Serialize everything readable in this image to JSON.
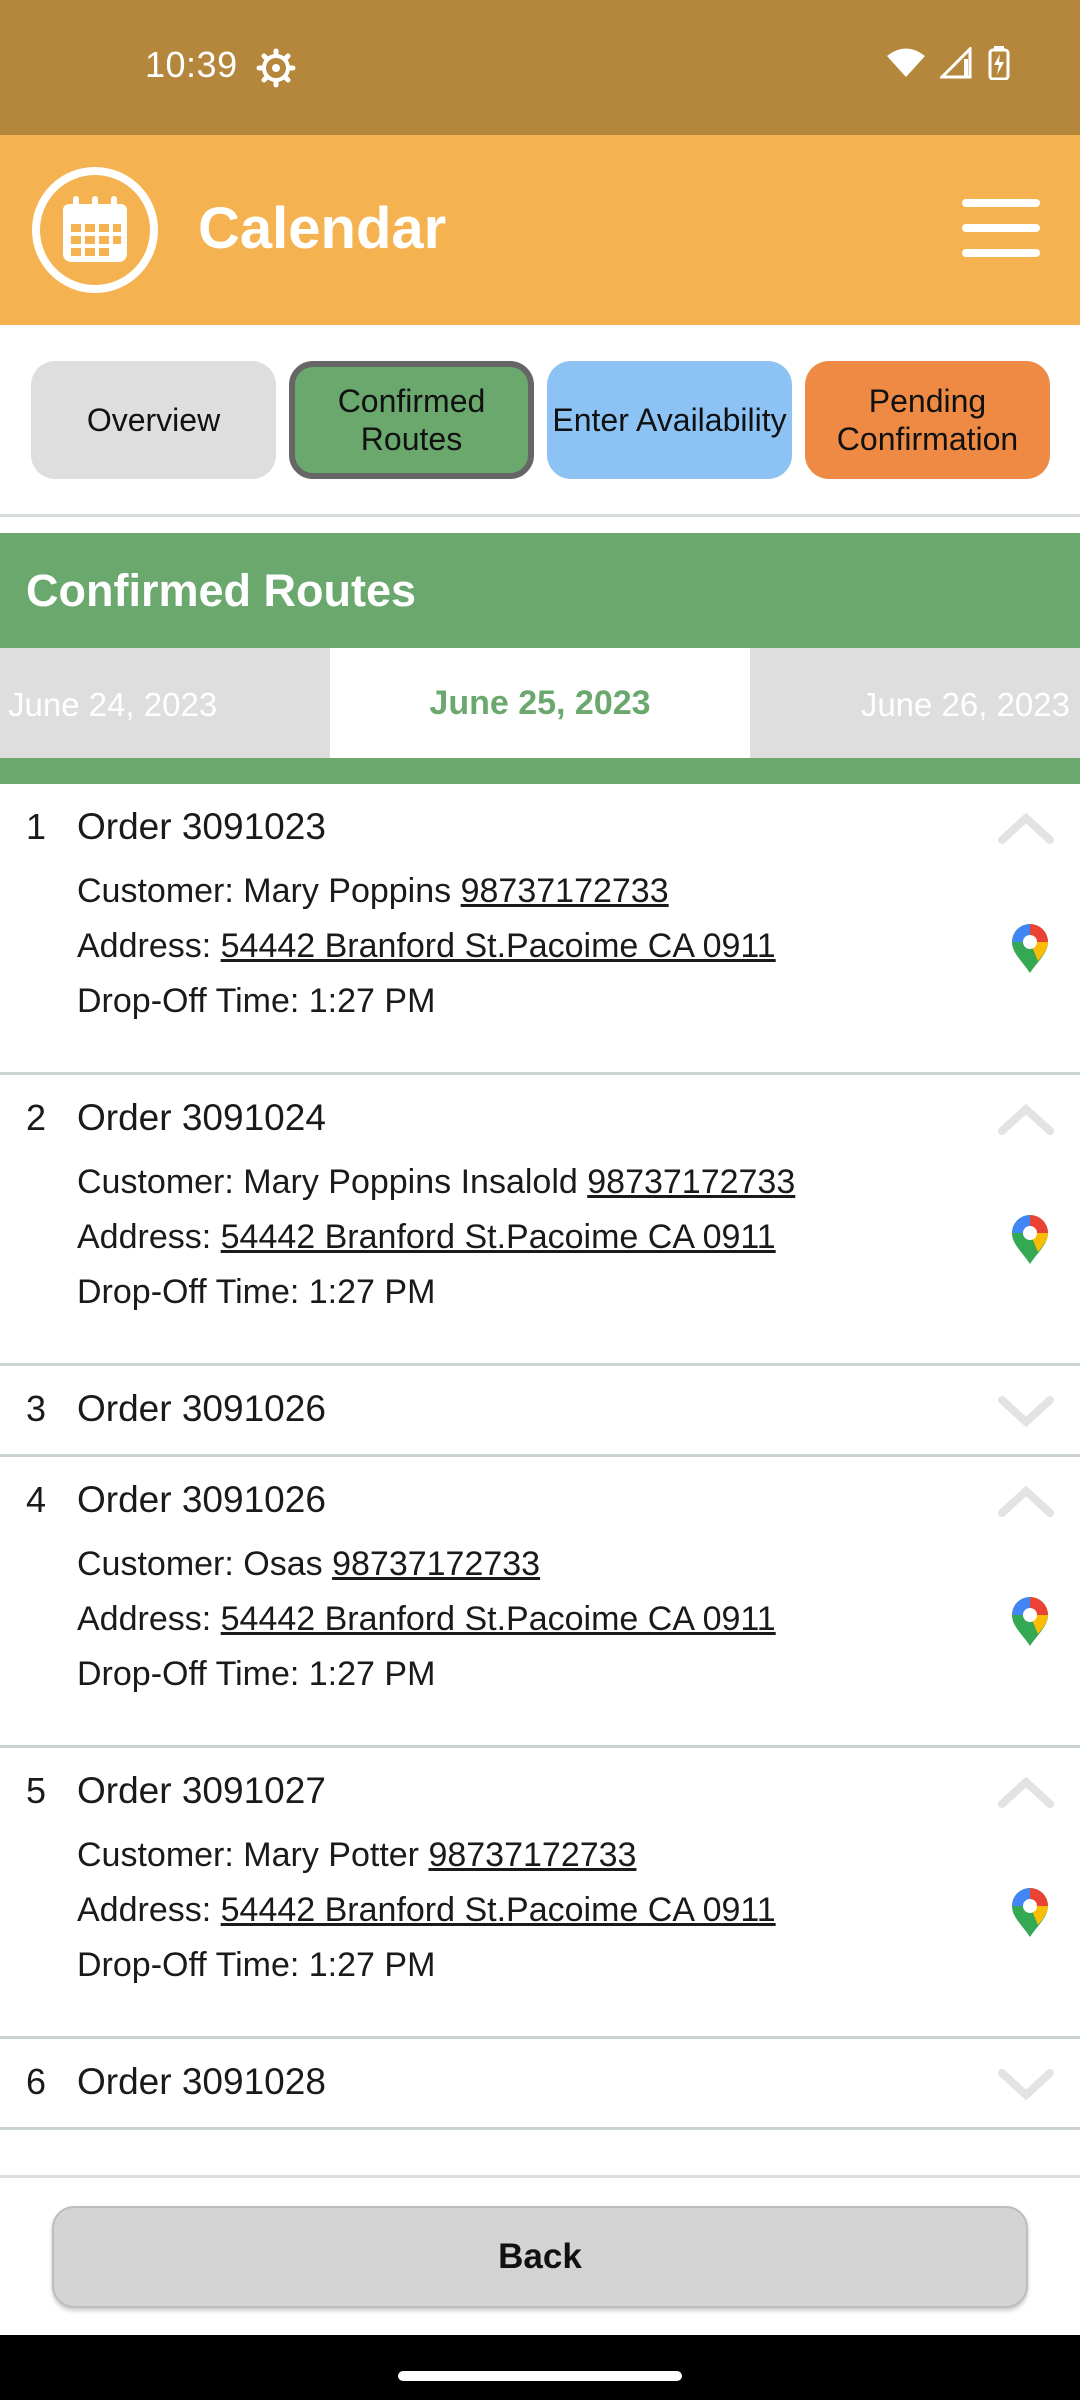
{
  "status_bar": {
    "time": "10:39"
  },
  "header": {
    "title": "Calendar"
  },
  "tabs": [
    {
      "label": "Overview"
    },
    {
      "label": "Confirmed Routes"
    },
    {
      "label": "Enter Availability"
    },
    {
      "label": "Pending Confirmation"
    }
  ],
  "section": {
    "title": "Confirmed Routes"
  },
  "dates": {
    "prev": "June 24, 2023",
    "current": "June 25, 2023",
    "next": "June 26, 2023"
  },
  "labels": {
    "customer": "Customer:",
    "address": "Address:",
    "dropoff": "Drop-Off Time:"
  },
  "orders": [
    {
      "index": "1",
      "title": "Order 3091023",
      "customer": "Mary Poppins",
      "phone": "98737172733",
      "address": "54442 Branford St.Pacoime CA 0911",
      "dropoff": "1:27 PM"
    },
    {
      "index": "2",
      "title": "Order 3091024",
      "customer": "Mary Poppins Insalold",
      "phone": "98737172733",
      "address": "54442 Branford St.Pacoime CA 0911",
      "dropoff": "1:27 PM"
    },
    {
      "index": "3",
      "title": "Order 3091026"
    },
    {
      "index": "4",
      "title": "Order 3091026",
      "customer": "Osas",
      "phone": "98737172733",
      "address": "54442 Branford St.Pacoime CA 0911",
      "dropoff": "1:27 PM"
    },
    {
      "index": "5",
      "title": "Order 3091027",
      "customer": "Mary Potter",
      "phone": "98737172733",
      "address": "54442 Branford St.Pacoime CA 0911",
      "dropoff": "1:27 PM"
    },
    {
      "index": "6",
      "title": "Order 3091028"
    }
  ],
  "footer": {
    "back_label": "Back"
  },
  "colors": {
    "status_bar": "#b5873c",
    "header": "#f4b350",
    "green": "#6aa86e",
    "blue": "#8cc3f4",
    "orange": "#ee8a44",
    "grey": "#dedede"
  },
  "icons": {
    "settings": "gear-icon",
    "wifi": "wifi-icon",
    "signal": "signal-icon",
    "battery": "battery-charging-icon",
    "logo": "calendar-icon",
    "menu": "hamburger-menu-icon",
    "map": "map-pin-icon",
    "expand": "chevron-down-icon",
    "collapse": "chevron-up-icon"
  }
}
